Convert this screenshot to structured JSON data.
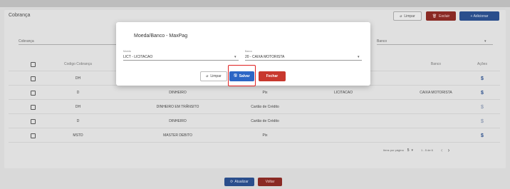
{
  "page": {
    "title": "Cobrança",
    "buttons": {
      "limpar": "Limpar",
      "excluir": "Excluir",
      "adicionar": "+ Adicionar"
    },
    "filters": {
      "cobranca_label": "Cobrança",
      "banco_label": "Banco"
    },
    "table": {
      "headers": [
        "Codigo Cobrança",
        "Banco",
        "Ações"
      ],
      "rows": [
        {
          "codigo": "DH",
          "moeda": "",
          "tipo": "",
          "licitacao": "",
          "banco": ""
        },
        {
          "codigo": "D",
          "moeda": "DINHEIRO",
          "tipo": "Pix",
          "licitacao": "LICITACAO",
          "banco": "CAIXA MOTORISTA"
        },
        {
          "codigo": "DH",
          "moeda": "DINHEIRO EM TRÂNSITO",
          "tipo": "Cartão de Crédito",
          "licitacao": "",
          "banco": ""
        },
        {
          "codigo": "D",
          "moeda": "DINHEIRO",
          "tipo": "Cartão de Crédito",
          "licitacao": "",
          "banco": ""
        },
        {
          "codigo": "MSTD",
          "moeda": "MASTER DEBITO",
          "tipo": "Pix",
          "licitacao": "",
          "banco": ""
        }
      ]
    },
    "pager": {
      "items_label": "Itens por página",
      "items_value": "5",
      "range": "1 - 5 de 6"
    },
    "bottom": {
      "atualizar": "Atualizar",
      "voltar": "Voltar"
    }
  },
  "modal": {
    "title": "Moeda/Banco - MaxPag",
    "moeda_label": "Moeda",
    "moeda_value": "LICT - LICITACAO",
    "banco_label": "Banco",
    "banco_value": "20 - CAIXA MOTORISTA",
    "limpar": "Limpar",
    "salvar": "Salvar",
    "fechar": "Fechar"
  }
}
